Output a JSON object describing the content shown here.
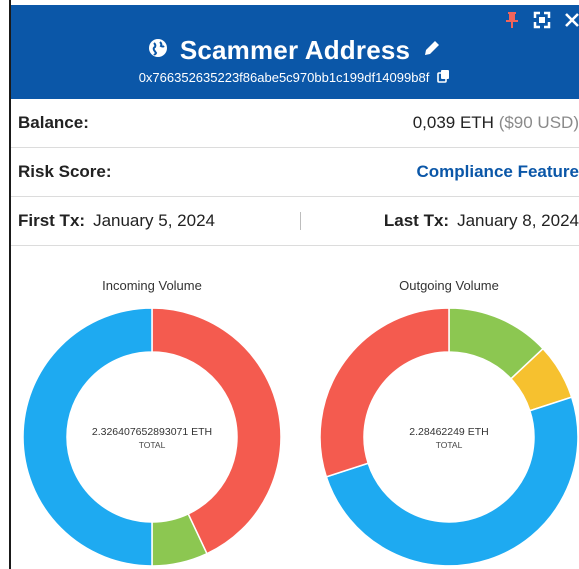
{
  "header": {
    "title": "Scammer Address",
    "address": "0x766352635223f86abe5c970bb1c199df14099b8f",
    "bg_color": "#0b57a8",
    "icons": [
      "globe-icon",
      "pencil-icon",
      "copy-icon",
      "pin-icon",
      "expand-icon",
      "close-icon"
    ]
  },
  "balance": {
    "label": "Balance:",
    "value": "0,039 ETH",
    "usd": "($90 USD)"
  },
  "risk": {
    "label": "Risk Score:",
    "link": "Compliance Feature"
  },
  "tx": {
    "first_label": "First Tx:",
    "first_date": "January 5, 2024",
    "last_label": "Last Tx:",
    "last_date": "January 8, 2024"
  },
  "chart_data": [
    {
      "type": "pie",
      "title": "Incoming Volume",
      "total_value": "2.326407652893071 ETH",
      "total_label": "TOTAL",
      "slices": [
        {
          "value": 43,
          "color": "#f45b4f"
        },
        {
          "value": 7,
          "color": "#8cc751"
        },
        {
          "value": 50,
          "color": "#1eaaf1"
        }
      ]
    },
    {
      "type": "pie",
      "title": "Outgoing Volume",
      "total_value": "2.28462249 ETH",
      "total_label": "TOTAL",
      "slices": [
        {
          "value": 13,
          "color": "#8cc751"
        },
        {
          "value": 7,
          "color": "#f6c12f"
        },
        {
          "value": 50,
          "color": "#1eaaf1"
        },
        {
          "value": 30,
          "color": "#f45b4f"
        }
      ]
    }
  ]
}
